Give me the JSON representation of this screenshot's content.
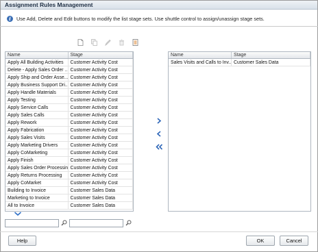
{
  "window": {
    "title": "Assignment Rules Management"
  },
  "info": {
    "text": "Use Add, Delete and Edit buttons to modify the list stage sets. Use shuttle control to assign/unassign stage sets."
  },
  "toolbar": {
    "icons": [
      "new-icon",
      "copy-icon",
      "edit-icon",
      "delete-icon",
      "export-icon"
    ]
  },
  "left_table": {
    "columns": [
      "Name",
      "Stage"
    ],
    "rows": [
      [
        "Apply All Building Activities",
        "Customer Activity Cost"
      ],
      [
        "Delete - Apply Sales Order ...",
        "Customer Activity Cost"
      ],
      [
        "Apply Ship and Order Asse...",
        "Customer Activity Cost"
      ],
      [
        "Apply Business Support Dri...",
        "Customer Activity Cost"
      ],
      [
        "Apply Handle Materials",
        "Customer Activity Cost"
      ],
      [
        "Apply Testing",
        "Customer Activity Cost"
      ],
      [
        "Apply Service Calls",
        "Customer Activity Cost"
      ],
      [
        "Apply Sales Calls",
        "Customer Activity Cost"
      ],
      [
        "Apply Rework",
        "Customer Activity Cost"
      ],
      [
        "Apply Fabrication",
        "Customer Activity Cost"
      ],
      [
        "Apply Sales Visits",
        "Customer Activity Cost"
      ],
      [
        "Apply Marketing Drivers",
        "Customer Activity Cost"
      ],
      [
        "Apply CoMarketing",
        "Customer Activity Cost"
      ],
      [
        "Apply Finish",
        "Customer Activity Cost"
      ],
      [
        "Apply Sales Order Processing",
        "Customer Activity Cost"
      ],
      [
        "Apply Returns Processing",
        "Customer Activity Cost"
      ],
      [
        "Apply CoMarket",
        "Customer Activity Cost"
      ],
      [
        "Building to Invoice",
        "Customer Sales Data"
      ],
      [
        "Marketing to Invoice",
        "Customer Sales Data"
      ],
      [
        "All to Invoice",
        "Customer Sales Data"
      ]
    ]
  },
  "right_table": {
    "columns": [
      "Name",
      "Stage"
    ],
    "rows": [
      [
        "Sales Visits and Calls to Inv...",
        "Customer Sales Data"
      ]
    ]
  },
  "filters": {
    "name_value": "",
    "stage_value": ""
  },
  "buttons": {
    "help": "Help",
    "ok": "OK",
    "cancel": "Cancel"
  }
}
